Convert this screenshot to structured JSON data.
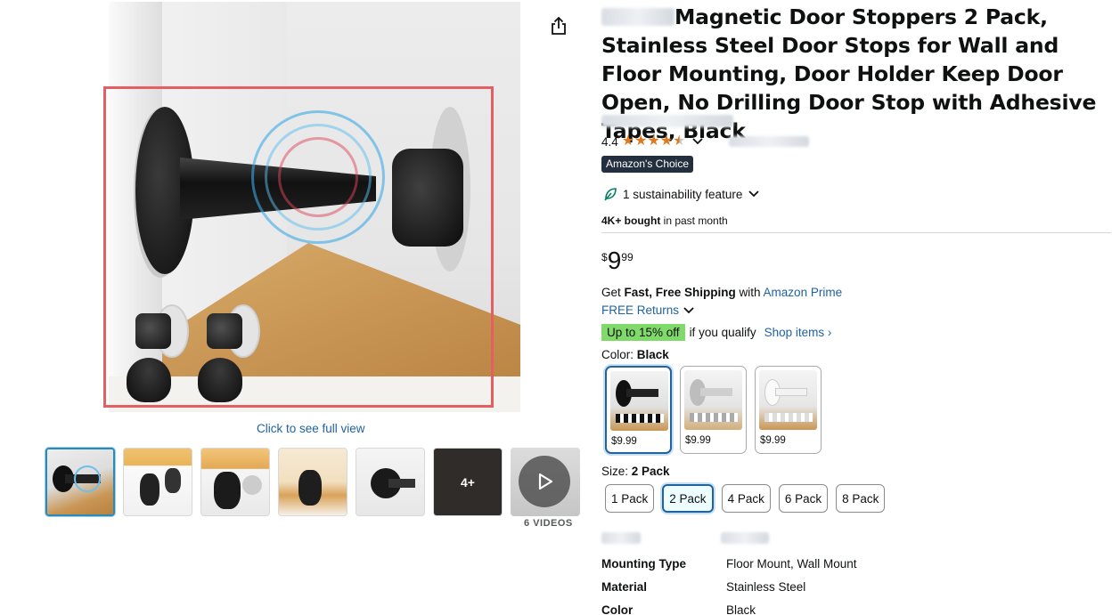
{
  "gallery": {
    "full_view_link": "Click to see full view",
    "thumbnails": [
      {
        "name": "thumbnail-1",
        "label": ""
      },
      {
        "name": "thumbnail-2",
        "label": ""
      },
      {
        "name": "thumbnail-3",
        "label": ""
      },
      {
        "name": "thumbnail-4",
        "label": ""
      },
      {
        "name": "thumbnail-5",
        "label": ""
      },
      {
        "name": "thumbnail-6",
        "label": "4+"
      }
    ],
    "videos_label": "6 VIDEOS",
    "highlight_color": "#e45f61",
    "active_thumb_color": "#2b8bb8"
  },
  "product": {
    "title": "Magnetic Door Stoppers 2 Pack, Stainless Steel Door Stops for Wall and Floor Mounting, Door Holder Keep Door Open, No Drilling Door Stop with Adhesive Tapes, Black",
    "rating": "4.4",
    "rating_stars": 4.4,
    "badge": "Amazon's Choice",
    "sustainability": "1 sustainability feature",
    "bought_bold": "4K+ bought",
    "bought_rest": " in past month",
    "price": {
      "symbol": "$",
      "whole": "9",
      "fraction": "99"
    },
    "shipping": {
      "prefix": "Get ",
      "bold": "Fast, Free Shipping",
      "mid": " with ",
      "link": "Amazon Prime"
    },
    "returns": "FREE Returns",
    "promo": {
      "tag": "Up to 15% off",
      "text": "if you qualify",
      "link": "Shop items ›"
    },
    "color": {
      "label": "Color: ",
      "value": "Black"
    },
    "swatches": [
      {
        "price": "$9.99",
        "finish": "black"
      },
      {
        "price": "$9.99",
        "finish": "silver"
      },
      {
        "price": "$9.99",
        "finish": "white"
      }
    ],
    "size": {
      "label": "Size: ",
      "value": "2 Pack"
    },
    "sizes": [
      "1 Pack",
      "2 Pack",
      "4 Pack",
      "6 Pack",
      "8 Pack"
    ],
    "specs": [
      {
        "key": "Mounting Type",
        "value": "Floor Mount, Wall Mount"
      },
      {
        "key": "Material",
        "value": "Stainless Steel"
      },
      {
        "key": "Color",
        "value": "Black"
      }
    ]
  },
  "colors": {
    "link": "#2162a1",
    "star": "#de7921",
    "promo_green": "#7fda69",
    "badge_bg": "#232f3e"
  },
  "icons": [
    "share-icon",
    "chevron-down-icon",
    "leaf-icon",
    "star-icon",
    "play-icon"
  ]
}
